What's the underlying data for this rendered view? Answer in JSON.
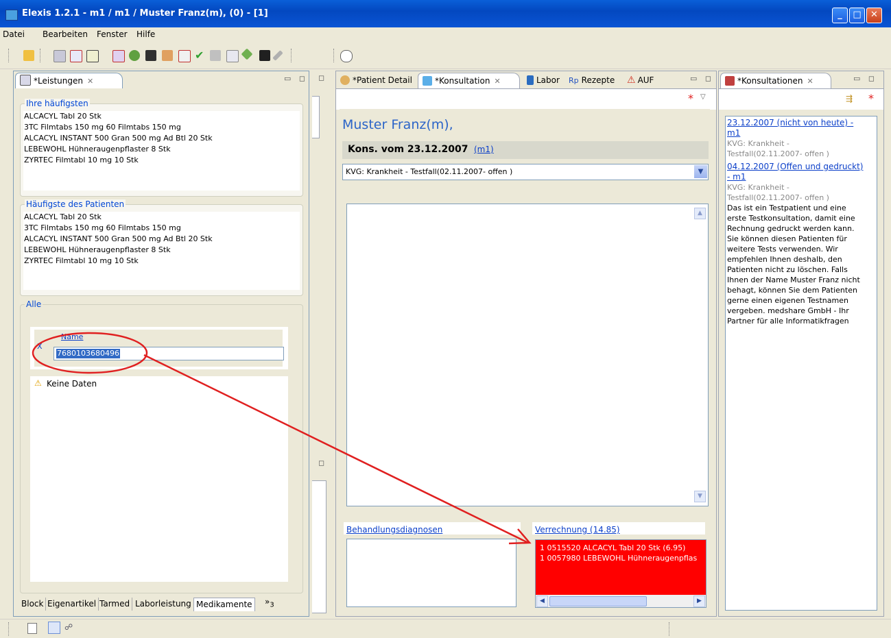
{
  "window": {
    "title": "Elexis 1.2.1 -  m1 / m1  / Muster Franz(m), (0) - [1]"
  },
  "menu": {
    "items": [
      "Datei",
      "Bearbeiten",
      "Fenster",
      "Hilfe"
    ]
  },
  "leistungen": {
    "tab_label": "*Leistungen",
    "frequent_title": "Ihre häufigsten",
    "frequent_items": [
      "ALCACYL Tabl 20 Stk",
      "3TC Filmtabs 150 mg 60 Filmtabs 150 mg",
      "ALCACYL INSTANT 500 Gran 500 mg Ad Btl 20 Stk",
      "LEBEWOHL Hühneraugenpflaster 8 Stk",
      "ZYRTEC Filmtabl 10 mg 10 Stk"
    ],
    "patient_title": "Häufigste des Patienten",
    "patient_items": [
      "ALCACYL Tabl 20 Stk",
      "3TC Filmtabs 150 mg 60 Filmtabs 150 mg",
      "ALCACYL INSTANT 500 Gran 500 mg Ad Btl 20 Stk",
      "LEBEWOHL Hühneraugenpflaster 8 Stk",
      "ZYRTEC Filmtabl 10 mg 10 Stk"
    ],
    "all_title": "Alle",
    "name_label": "Name",
    "clear_label": "X",
    "search_value": "7680103680496",
    "no_data": "Keine Daten",
    "bottom_tabs": [
      "Block",
      "Eigenartikel",
      "Tarmed",
      "Laborleistung",
      "Medikamente"
    ],
    "more_tabs": "»",
    "more_tabs_count": "3"
  },
  "center": {
    "tabs": [
      "*Patient Detail",
      "*Konsultation",
      "Labor",
      "Rezepte",
      "AUF"
    ],
    "rp_label": "Rp",
    "patient_name": "Muster Franz(m),",
    "kons_title": "Kons. vom 23.12.2007",
    "kons_user": "(m1)",
    "fall_select": "KVG: Krankheit - Testfall(02.11.2007- offen )",
    "diag_label": "Behandlungsdiagnosen",
    "verr_label": "Verrechnung (14.85)",
    "verr_items": [
      "1 0515520 ALCACYL Tabl 20 Stk (6.95)",
      "1 0057980 LEBEWOHL Hühneraugenpflas"
    ],
    "colors": {
      "verrechnung_bg": "#ff0000",
      "dirty_star": "#e02020"
    }
  },
  "konsultationen": {
    "tab_label": "*Konsultationen",
    "entries": [
      {
        "link": "23.12.2007 (nicht von heute) - m1",
        "fall": "KVG: Krankheit - Testfall(02.11.2007- offen )",
        "text": ""
      },
      {
        "link": "04.12.2007 (Offen und gedruckt) - m1",
        "fall": "KVG: Krankheit - Testfall(02.11.2007- offen )",
        "text": "Das ist ein Testpatient und eine erste Testkonsultation, damit eine Rechnung gedruckt werden kann. Sie können diesen Patienten für weitere Tests verwenden. Wir empfehlen Ihnen deshalb, den Patienten nicht zu löschen. Falls Ihnen der Name Muster Franz nicht behagt, können Sie dem Patienten gerne einen eigenen Testnamen vergeben. medshare GmbH - Ihr Partner für alle Informatikfragen"
      }
    ]
  },
  "annotation": {
    "color": "#e02020"
  }
}
